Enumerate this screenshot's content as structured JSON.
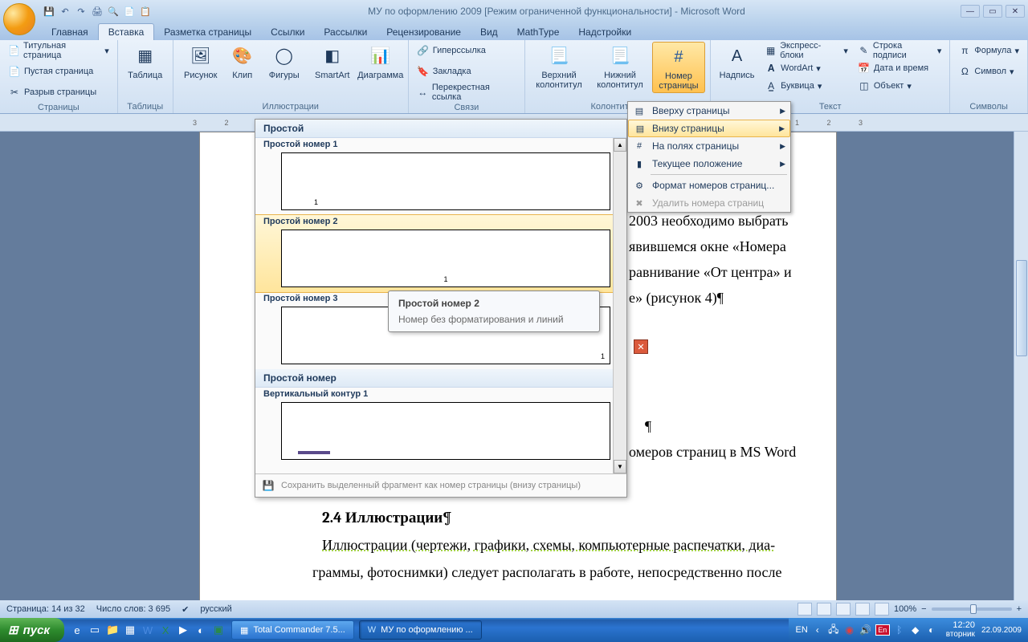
{
  "title": "МУ по оформлению 2009 [Режим ограниченной функциональности] - Microsoft Word",
  "qat": [
    "💾",
    "↶",
    "↷",
    "🖨",
    "🔍",
    "📄",
    "📋"
  ],
  "tabs": [
    "Главная",
    "Вставка",
    "Разметка страницы",
    "Ссылки",
    "Рассылки",
    "Рецензирование",
    "Вид",
    "MathType",
    "Надстройки"
  ],
  "active_tab": 1,
  "ribbon": {
    "pages": {
      "label": "Страницы",
      "items": [
        "Титульная страница",
        "Пустая страница",
        "Разрыв страницы"
      ]
    },
    "tables": {
      "label": "Таблицы",
      "btn": "Таблица"
    },
    "illus": {
      "label": "Иллюстрации",
      "items": [
        "Рисунок",
        "Клип",
        "Фигуры",
        "SmartArt",
        "Диаграмма"
      ]
    },
    "links": {
      "label": "Связи",
      "items": [
        "Гиперссылка",
        "Закладка",
        "Перекрестная ссылка"
      ]
    },
    "hf": {
      "label": "Колонтитулы",
      "items": [
        "Верхний колонтитул",
        "Нижний колонтитул",
        "Номер страницы"
      ]
    },
    "text": {
      "label": "Текст",
      "btn": "Надпись",
      "items": [
        "Экспресс-блоки",
        "WordArt",
        "Буквица",
        "Строка подписи",
        "Дата и время",
        "Объект"
      ]
    },
    "symbols": {
      "label": "Символы",
      "items": [
        "Формула",
        "Символ"
      ]
    }
  },
  "pn_menu": {
    "top": "Вверху страницы",
    "bottom": "Внизу страницы",
    "margins": "На полях страницы",
    "current": "Текущее положение",
    "format": "Формат номеров страниц...",
    "remove": "Удалить номера страниц"
  },
  "gallery": {
    "cat1": "Простой",
    "items": [
      "Простой номер 1",
      "Простой номер 2",
      "Простой номер 3"
    ],
    "cat2": "Простой номер",
    "item4": "Вертикальный контур 1",
    "footer": "Сохранить выделенный фрагмент как номер страницы (внизу страницы)"
  },
  "tooltip": {
    "title": "Простой номер 2",
    "desc": "Номер без форматирования и линий"
  },
  "doc": {
    "l1": "2003 необходимо выбрать",
    "l2": "явившемся окне «Номера",
    "l3": "равнивание «От центра» и",
    "l4": "е» (рисунок 4)¶",
    "l5": "¶",
    "l6": "омеров страниц в MS Word",
    "h": "2.4 Иллюстрации¶",
    "l7": "Иллюстрации (чертежи, графики, схемы, компьютерные распечатки, диа-",
    "l8": "граммы, фотоснимки) следует располагать в работе, непосредственно после"
  },
  "status": {
    "page": "Страница: 14 из 32",
    "words": "Число слов: 3 695",
    "lang": "русский",
    "zoom": "100%"
  },
  "ruler": "3 2 1 ",
  "ruler2": " 1 2 3",
  "taskbar": {
    "start": "пуск",
    "task1": "Total Commander 7.5...",
    "task2": "МУ по оформлению ...",
    "lang_txt": "EN",
    "lang_badge": "En",
    "time": "12:20",
    "date": "22.09.2009",
    "day": "вторник"
  }
}
